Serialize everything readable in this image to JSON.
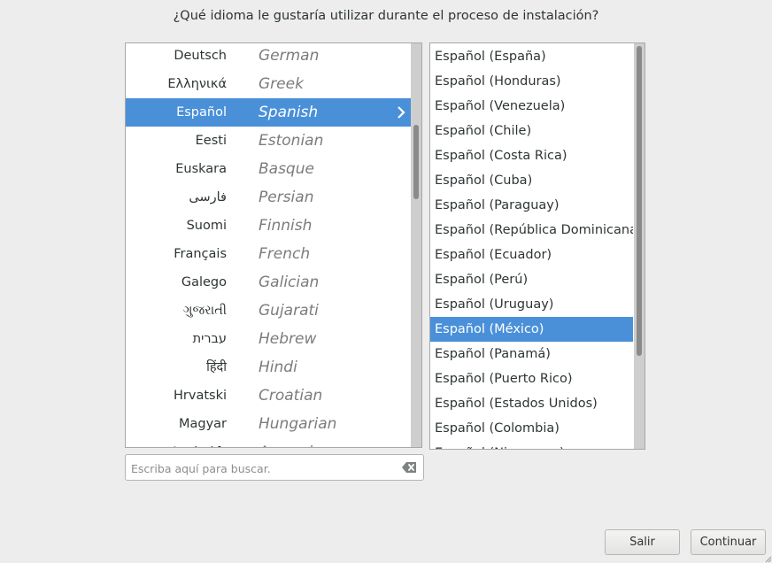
{
  "prompt": "¿Qué idioma le gustaría utilizar durante el proceso de instalación?",
  "languages": [
    {
      "native": "Deutsch",
      "english": "German"
    },
    {
      "native": "Ελληνικά",
      "english": "Greek"
    },
    {
      "native": "Español",
      "english": "Spanish",
      "selected": true
    },
    {
      "native": "Eesti",
      "english": "Estonian"
    },
    {
      "native": "Euskara",
      "english": "Basque"
    },
    {
      "native": "فارسی",
      "english": "Persian"
    },
    {
      "native": "Suomi",
      "english": "Finnish"
    },
    {
      "native": "Français",
      "english": "French"
    },
    {
      "native": "Galego",
      "english": "Galician"
    },
    {
      "native": "ગુજરાતી",
      "english": "Gujarati"
    },
    {
      "native": "עברית",
      "english": "Hebrew"
    },
    {
      "native": "हिंदी",
      "english": "Hindi"
    },
    {
      "native": "Hrvatski",
      "english": "Croatian"
    },
    {
      "native": "Magyar",
      "english": "Hungarian"
    },
    {
      "native": "Հայերեն",
      "english": "Armenian"
    }
  ],
  "locales": [
    {
      "label": "Español (España)"
    },
    {
      "label": "Español (Honduras)"
    },
    {
      "label": "Español (Venezuela)"
    },
    {
      "label": "Español (Chile)"
    },
    {
      "label": "Español (Costa Rica)"
    },
    {
      "label": "Español (Cuba)"
    },
    {
      "label": "Español (Paraguay)"
    },
    {
      "label": "Español (República Dominicana)"
    },
    {
      "label": "Español (Ecuador)"
    },
    {
      "label": "Español (Perú)"
    },
    {
      "label": "Español (Uruguay)"
    },
    {
      "label": "Español (México)",
      "selected": true
    },
    {
      "label": "Español (Panamá)"
    },
    {
      "label": "Español (Puerto Rico)"
    },
    {
      "label": "Español (Estados Unidos)"
    },
    {
      "label": "Español (Colombia)"
    },
    {
      "label": "Español (Nicaragua)"
    }
  ],
  "search": {
    "placeholder": "Escriba aquí para buscar.",
    "value": ""
  },
  "buttons": {
    "quit": "Salir",
    "continue": "Continuar"
  },
  "icons": {
    "selected_row_arrow": "chevron-right-icon",
    "search_clear": "clear-text-icon"
  },
  "colors": {
    "selection": "#4a90d9",
    "background": "#ededed",
    "secondary_text": "#7a7d7b"
  }
}
